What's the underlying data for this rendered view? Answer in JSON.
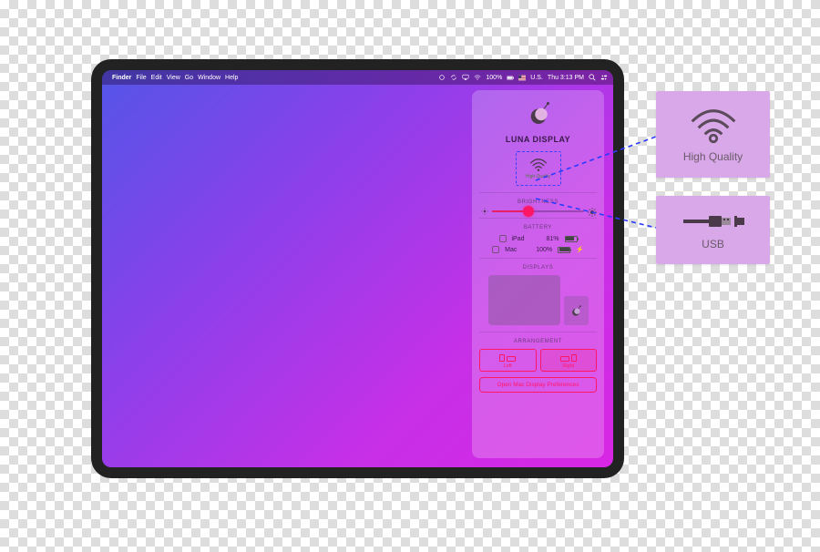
{
  "menubar": {
    "apple": "",
    "app": "Finder",
    "items": [
      "File",
      "Edit",
      "View",
      "Go",
      "Window",
      "Help"
    ],
    "right": {
      "battery_percent": "100%",
      "locale": "U.S.",
      "clock": "Thu 3:13 PM"
    }
  },
  "panel": {
    "title": "LUNA DISPLAY",
    "connection_quality": "High Quality",
    "sections": {
      "brightness": "BRIGHTNESS",
      "battery": "BATTERY",
      "displays": "DISPLAYS",
      "arrangement": "ARRANGEMENT"
    },
    "battery": {
      "ipad_name": "iPad",
      "ipad_pct": "81%",
      "mac_name": "Mac",
      "mac_pct": "100%"
    },
    "arrangement": {
      "left": "Left",
      "right": "Right"
    },
    "prefs_button": "Open Mac Display Preferences"
  },
  "callouts": {
    "wifi_label": "High Quality",
    "usb_label": "USB"
  }
}
